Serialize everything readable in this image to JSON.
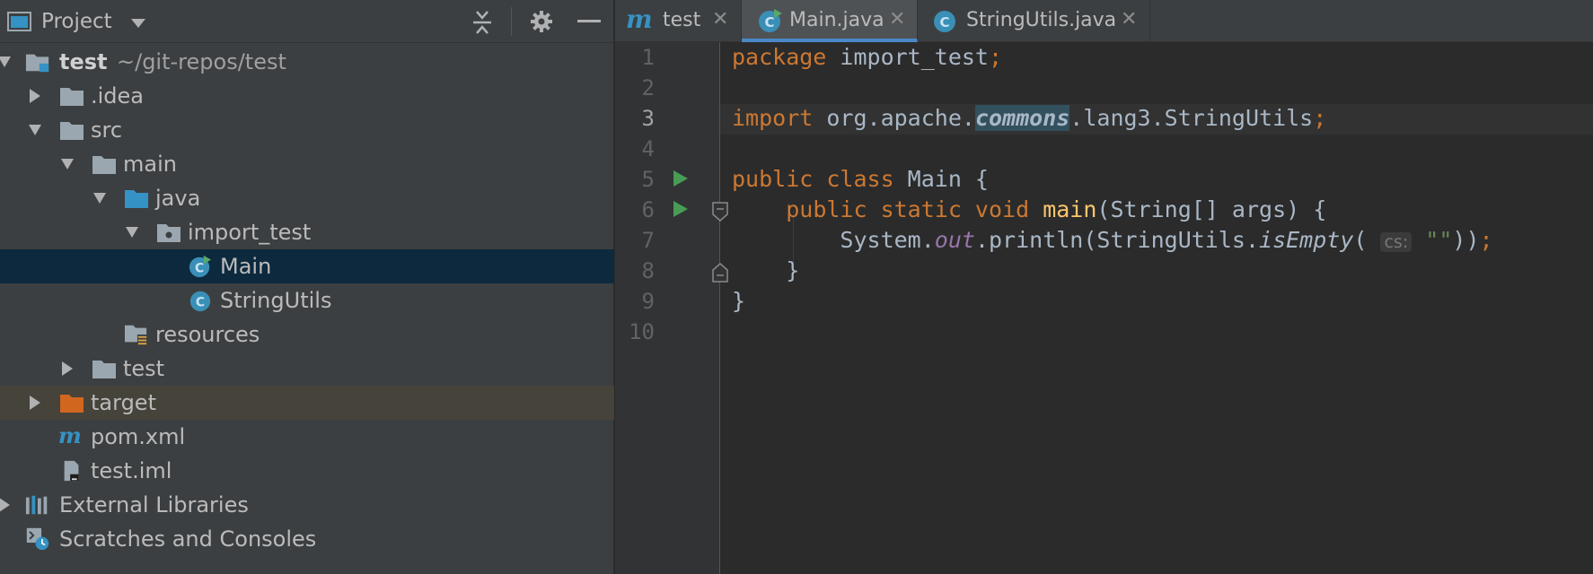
{
  "panel": {
    "title": "Project",
    "tree": [
      {
        "id": "root",
        "label": "test",
        "sub": "~/git-repos/test"
      },
      {
        "id": "idea",
        "label": ".idea"
      },
      {
        "id": "src",
        "label": "src"
      },
      {
        "id": "main-dir",
        "label": "main"
      },
      {
        "id": "java",
        "label": "java"
      },
      {
        "id": "import-test",
        "label": "import_test"
      },
      {
        "id": "main-class",
        "label": "Main"
      },
      {
        "id": "stringutils-class",
        "label": "StringUtils"
      },
      {
        "id": "resources",
        "label": "resources"
      },
      {
        "id": "test-dir",
        "label": "test"
      },
      {
        "id": "target",
        "label": "target"
      },
      {
        "id": "pom",
        "label": "pom.xml"
      },
      {
        "id": "iml",
        "label": "test.iml"
      },
      {
        "id": "ext-libs",
        "label": "External Libraries"
      },
      {
        "id": "scratches",
        "label": "Scratches and Consoles"
      }
    ]
  },
  "tabs": [
    {
      "label": "test"
    },
    {
      "label": "Main.java"
    },
    {
      "label": "StringUtils.java"
    }
  ],
  "tab_close_glyph": "✕",
  "editor": {
    "line_numbers": [
      "1",
      "2",
      "3",
      "4",
      "5",
      "6",
      "7",
      "8",
      "9",
      "10"
    ],
    "current_line": 3,
    "code": {
      "l1_kw": "package",
      "l1_rest": " import_test",
      "l1_semi": ";",
      "l3_kw": "import",
      "l3_a": " org.apache.",
      "l3_hl": "commons",
      "l3_b": ".lang3.StringUtils",
      "l3_semi": ";",
      "l5_kw": "public class",
      "l5_rest": " Main {",
      "l6_indent": "    ",
      "l6_kw": "public static void",
      "l6_fn": " main",
      "l6_rest": "(String[] args) {",
      "l7_indent": "        ",
      "l7_a": "System.",
      "l7_out": "out",
      "l7_b": ".println(StringUtils.",
      "l7_isempty": "isEmpty",
      "l7_paren": "( ",
      "l7_hint": "cs:",
      "l7_str": " \"\"",
      "l7_close": "))",
      "l7_semi": ";",
      "l8": "    }",
      "l9": "}"
    }
  },
  "colors": {
    "keyword": "#cc7832",
    "function": "#ffc66d",
    "field": "#9876aa",
    "string": "#6a8759",
    "selection": "#0d293e",
    "tab_accent": "#4a88c7",
    "folder_source": "#3592c4",
    "folder_excluded": "#d1661f"
  },
  "icons": [
    "project-icon",
    "dropdown-icon",
    "collapse-all-icon",
    "gear-icon",
    "minimize-icon",
    "folder-icon",
    "module-icon",
    "package-icon",
    "class-icon",
    "maven-icon",
    "iml-file-icon",
    "libraries-icon",
    "scratches-icon",
    "run-icon",
    "fold-icon",
    "close-icon"
  ]
}
